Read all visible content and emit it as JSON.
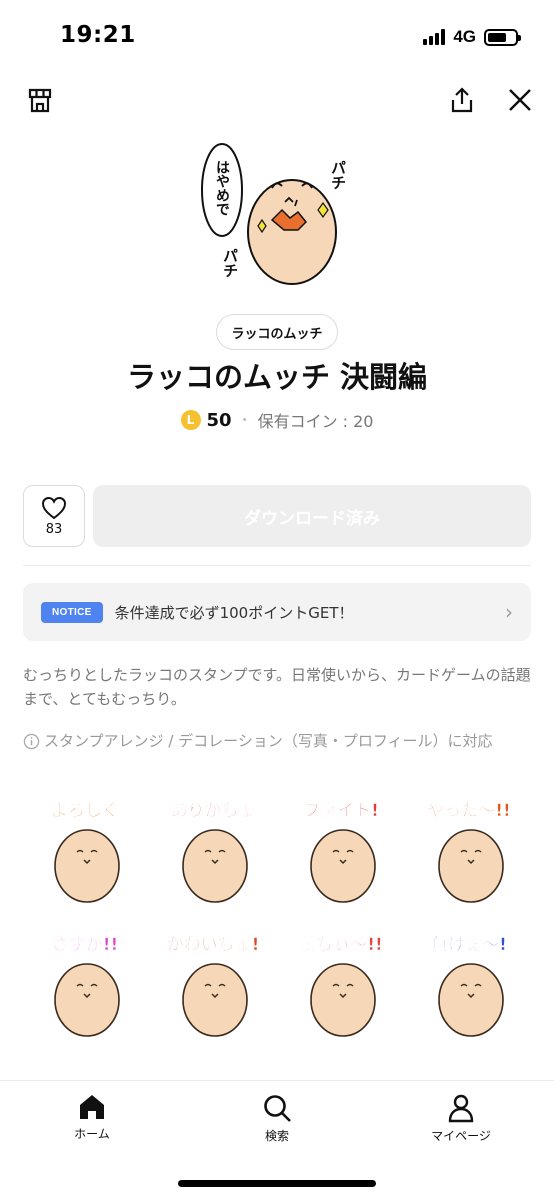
{
  "status_bar": {
    "time": "19:21",
    "network": "4G",
    "battery_level": 0.7
  },
  "top_nav": {
    "left_icon": "shop-icon",
    "share_icon": "share-icon",
    "close_icon": "close-icon"
  },
  "main_sticker": {
    "text_bubble": "はやめで",
    "sfx_top": "パチ",
    "sfx_bottom": "パチ"
  },
  "product": {
    "author": "ラッコのムッチ",
    "title": "ラッコのムッチ 決闘編",
    "coin_symbol": "L",
    "price": "50",
    "separator": "・",
    "owned_coins": "保有コイン : 20"
  },
  "actions": {
    "like_count": "83",
    "download_label": "ダウンロード済み"
  },
  "notice": {
    "badge": "NOTICE",
    "text": "条件達成で必ず100ポイントGET！"
  },
  "description": "むっちりとしたラッコのスタンプです。日常使いから、カードゲームの話題まで、とてもむっちり。",
  "arrange_note": "スタンプアレンジ / デコレーション（写真・プロフィール）に対応",
  "stickers": [
    {
      "text": "よろしく",
      "color": "#f07a1a"
    },
    {
      "text": "ありがちょ",
      "color": "#e0445a"
    },
    {
      "text": "ファイト!",
      "color": "#e23b3b"
    },
    {
      "text": "やった〜!!",
      "color": "#e35a1a"
    },
    {
      "text": "さすが!!",
      "color": "#d84bd0"
    },
    {
      "text": "かわいちょ!",
      "color": "#d64a28"
    },
    {
      "text": "勝ちぃ〜!!",
      "color": "#e24646"
    },
    {
      "text": "負けぇ〜!",
      "color": "#2f4fd6"
    }
  ],
  "bottom_nav": {
    "home": "ホーム",
    "search": "検索",
    "mypage": "マイページ"
  },
  "colors": {
    "accent_blue": "#4e83f0",
    "coin_yellow": "#f6c02f",
    "otter_body": "#f6d8b8"
  }
}
